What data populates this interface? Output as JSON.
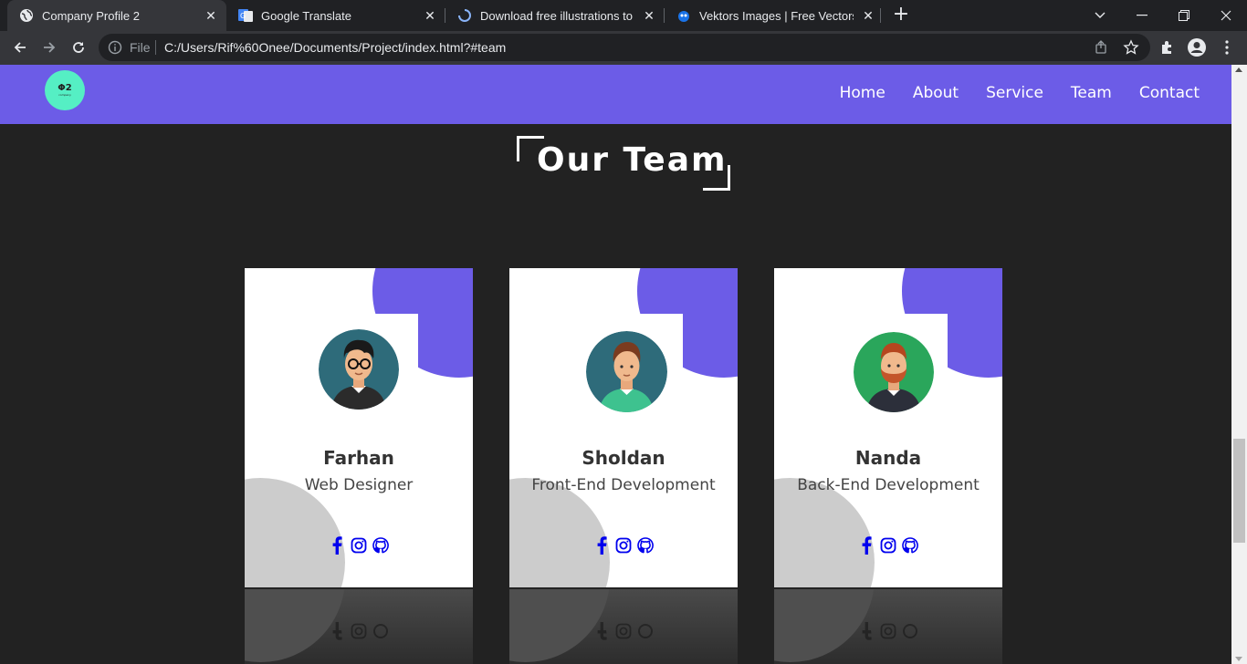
{
  "browser": {
    "tabs": [
      {
        "label": "Company Profile 2",
        "active": true,
        "favicon": "globe-icon"
      },
      {
        "label": "Google Translate",
        "active": false,
        "favicon": "google-translate-icon"
      },
      {
        "label": "Download free illustrations to po",
        "active": false,
        "favicon": "loading-spinner-icon"
      },
      {
        "label": "Vektors Images | Free Vectors, St",
        "active": false,
        "favicon": "vektors-icon"
      }
    ],
    "address": {
      "scheme_label": "File",
      "url": "C:/Users/Rif%60Onee/Documents/Project/index.html?#team"
    }
  },
  "site": {
    "logo": {
      "text": "Φ2",
      "sub": "company"
    },
    "nav": [
      {
        "label": "Home"
      },
      {
        "label": "About"
      },
      {
        "label": "Service"
      },
      {
        "label": "Team"
      },
      {
        "label": "Contact"
      }
    ],
    "section_title": "Our Team",
    "members": [
      {
        "name": "Farhan",
        "role": "Web Designer",
        "avatar": "avatar-glasses-icon"
      },
      {
        "name": "Sholdan",
        "role": "Front-End Development",
        "avatar": "avatar-green-shirt-icon"
      },
      {
        "name": "Nanda",
        "role": "Back-End Development",
        "avatar": "avatar-bearded-icon"
      }
    ]
  },
  "colors": {
    "brand_purple": "#6c5ce7",
    "logo_teal": "#55efc4",
    "page_bg": "#222222",
    "social_blue": "#0000ee"
  }
}
